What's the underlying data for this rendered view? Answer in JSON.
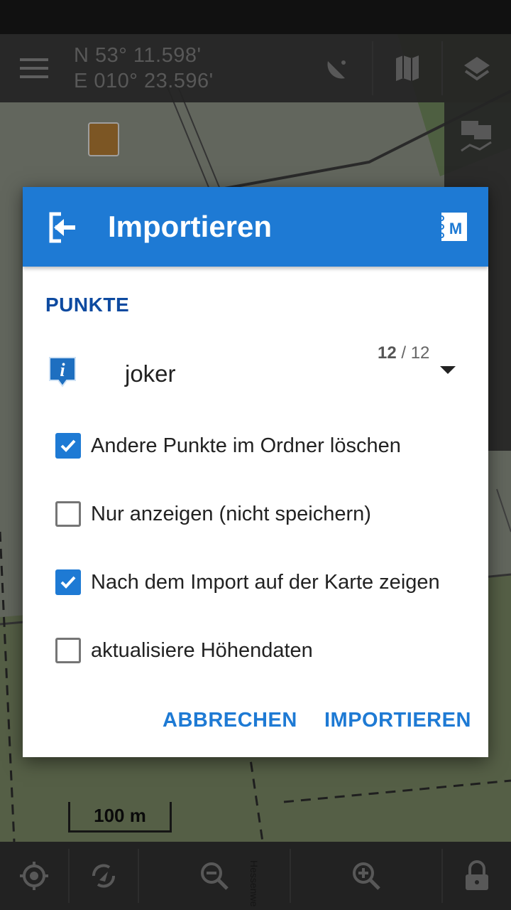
{
  "map": {
    "coord_lat": "N 53° 11.598'",
    "coord_lon": "E 010° 23.596'",
    "scale_label": "100 m",
    "street_label": "Hessenwe"
  },
  "dialog": {
    "title": "Importieren",
    "section_label": "PUNKTE",
    "folder_name": "joker",
    "count_selected": "12",
    "count_total": "/ 12",
    "options": [
      {
        "label": "Andere Punkte im Ordner löschen",
        "checked": true
      },
      {
        "label": "Nur anzeigen (nicht speichern)",
        "checked": false
      },
      {
        "label": "Nach dem Import auf der Karte zeigen",
        "checked": true
      },
      {
        "label": "aktualisiere Höhendaten",
        "checked": false
      }
    ],
    "cancel_label": "ABBRECHEN",
    "import_label": "IMPORTIEREN"
  },
  "colors": {
    "accent": "#1e7ad4",
    "section": "#0d4aa0",
    "toolbar": "#3a3a3a"
  },
  "icons": [
    "menu-icon",
    "satellite-icon",
    "map-icon",
    "layers-icon",
    "chat-icon",
    "import-icon",
    "notebook-icon",
    "info-poi-icon",
    "checkmark-icon",
    "gps-icon",
    "rotate-icon",
    "zoom-out-icon",
    "zoom-in-icon",
    "lock-icon"
  ]
}
